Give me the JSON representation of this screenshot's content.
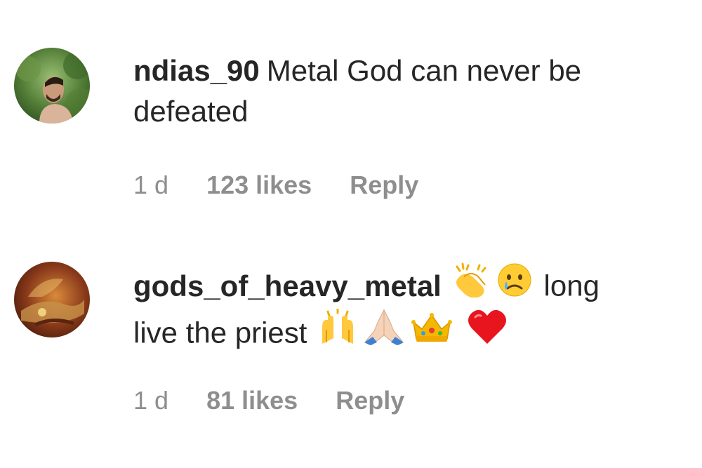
{
  "comments": [
    {
      "username": "ndias_90",
      "text_line1": "Metal God can never be",
      "text_line2": "defeated",
      "time": "1 d",
      "likes": "123 likes",
      "reply_label": "Reply"
    },
    {
      "username": "gods_of_heavy_metal",
      "text_part1": "long",
      "text_part2": "live the priest",
      "emojis_line1": [
        "clapping-hands-icon",
        "crying-face-icon"
      ],
      "emojis_line2": [
        "raising-hands-icon",
        "praying-hands-icon",
        "crown-icon",
        "red-heart-icon"
      ],
      "time": "1 d",
      "likes": "81 likes",
      "reply_label": "Reply"
    }
  ],
  "colors": {
    "text": "#262626",
    "meta": "#8e8e8e",
    "background": "#ffffff"
  }
}
